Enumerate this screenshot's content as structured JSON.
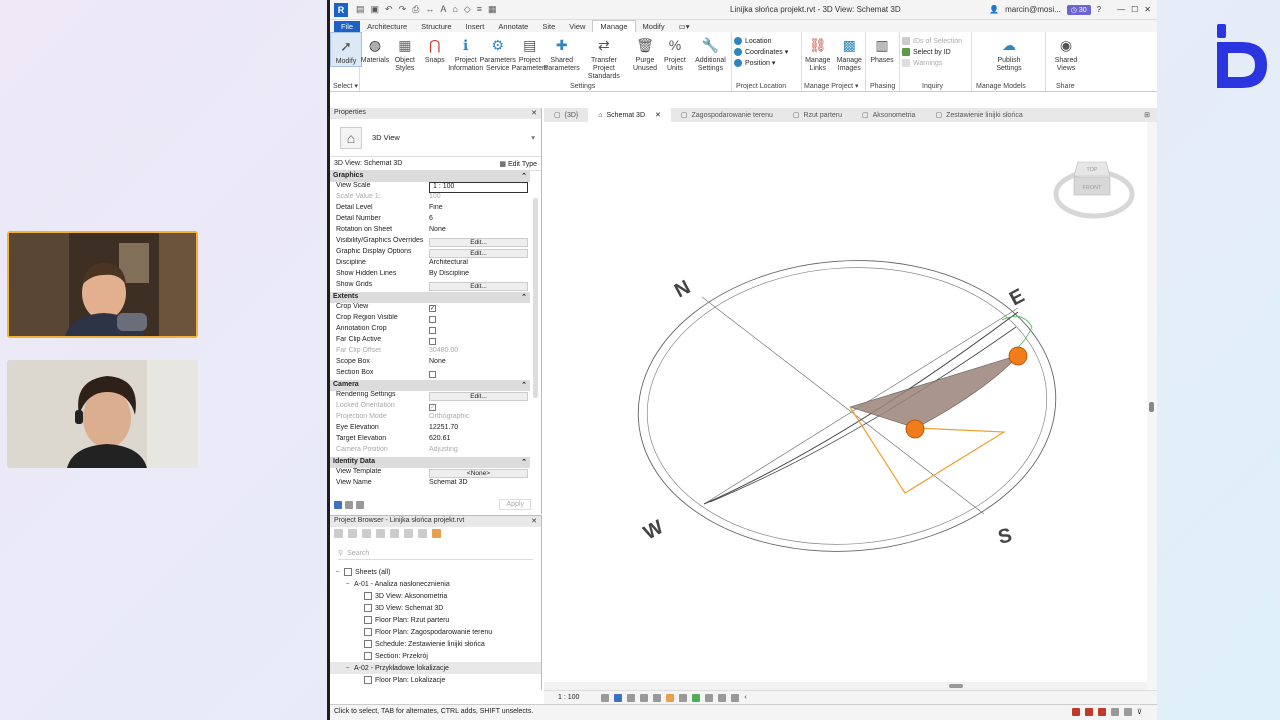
{
  "app": {
    "title": "Linijka słońca projekt.rvt - 3D View: Schemat 3D",
    "user": "marcin@mosi...",
    "badge": "30",
    "help": "?"
  },
  "ribbon_tabs": [
    "File",
    "Architecture",
    "Structure",
    "Insert",
    "Annotate",
    "Site",
    "View",
    "Manage",
    "Modify"
  ],
  "active_tab": "Manage",
  "ribbon": {
    "select": {
      "button": "Modify",
      "panel": "Select ▾"
    },
    "settings": {
      "buttons": [
        "Materials",
        "Object\nStyles",
        "Snaps",
        "Project\nInformation",
        "Parameters\nService",
        "Project\nParameters",
        "Shared\nParameters",
        "Transfer\nProject Standards",
        "Purge\nUnused",
        "Project\nUnits",
        "Additional\nSettings"
      ],
      "panel": "Settings"
    },
    "location": {
      "items": [
        "Location",
        "Coordinates ▾",
        "Position ▾"
      ],
      "panel": "Project Location"
    },
    "manage_project": {
      "buttons": [
        "Manage\nLinks",
        "Manage\nImages"
      ],
      "panel": "Manage Project ▾"
    },
    "phasing": {
      "button": "Phases",
      "panel": "Phasing"
    },
    "inquiry": {
      "items": [
        "IDs of Selection",
        "Select by ID",
        "Warnings"
      ],
      "panel": "Inquiry"
    },
    "manage_models": {
      "button": "Publish\nSettings",
      "panel": "Manage Models"
    },
    "share": {
      "button": "Shared\nViews",
      "panel": "Share"
    }
  },
  "properties": {
    "header": "Properties",
    "type_name": "3D View",
    "view_selector": "3D View: Schemat 3D",
    "edit_type": "Edit Type",
    "groups": [
      {
        "name": "Graphics",
        "rows": [
          {
            "k": "View Scale",
            "v": "1 : 100",
            "kind": "input"
          },
          {
            "k": "Scale Value  1:",
            "v": "100",
            "kind": "dim"
          },
          {
            "k": "Detail Level",
            "v": "Fine"
          },
          {
            "k": "Detail Number",
            "v": "6"
          },
          {
            "k": "Rotation on Sheet",
            "v": "None"
          },
          {
            "k": "Visibility/Graphics Overrides",
            "v": "Edit...",
            "kind": "btn"
          },
          {
            "k": "Graphic Display Options",
            "v": "Edit...",
            "kind": "btn"
          },
          {
            "k": "Discipline",
            "v": "Architectural"
          },
          {
            "k": "Show Hidden Lines",
            "v": "By Discipline"
          },
          {
            "k": "Show Grids",
            "v": "Edit...",
            "kind": "btn"
          }
        ]
      },
      {
        "name": "Extents",
        "rows": [
          {
            "k": "Crop View",
            "v": "✓",
            "kind": "chk"
          },
          {
            "k": "Crop Region Visible",
            "v": "",
            "kind": "chk"
          },
          {
            "k": "Annotation Crop",
            "v": "",
            "kind": "chk"
          },
          {
            "k": "Far Clip Active",
            "v": "",
            "kind": "chk"
          },
          {
            "k": "Far Clip Offset",
            "v": "30480.00",
            "kind": "dim"
          },
          {
            "k": "Scope Box",
            "v": "None"
          },
          {
            "k": "Section Box",
            "v": "",
            "kind": "chk"
          }
        ]
      },
      {
        "name": "Camera",
        "rows": [
          {
            "k": "Rendering Settings",
            "v": "Edit...",
            "kind": "btn"
          },
          {
            "k": "Locked Orientation",
            "v": "✓",
            "kind": "chkdim"
          },
          {
            "k": "Projection Mode",
            "v": "Orthographic",
            "kind": "dim"
          },
          {
            "k": "Eye Elevation",
            "v": "12251.70"
          },
          {
            "k": "Target Elevation",
            "v": "620.61"
          },
          {
            "k": "Camera Position",
            "v": "Adjusting",
            "kind": "dim"
          }
        ]
      },
      {
        "name": "Identity Data",
        "rows": [
          {
            "k": "View Template",
            "v": "<None>",
            "kind": "btn"
          },
          {
            "k": "View Name",
            "v": "Schemat 3D"
          }
        ]
      }
    ],
    "apply": "Apply"
  },
  "project_browser": {
    "header": "Project Browser - Linijka słońca projekt.rvt",
    "search_placeholder": "Search",
    "items": [
      {
        "label": "Sheets (all)",
        "level": 0,
        "toggle": "−"
      },
      {
        "label": "A-01 - Analiza nasłonecznienia",
        "level": 1,
        "toggle": "−"
      },
      {
        "label": "3D View: Aksonometria",
        "level": 2,
        "toggle": ""
      },
      {
        "label": "3D View: Schemat 3D",
        "level": 2,
        "toggle": ""
      },
      {
        "label": "Floor Plan: Rzut parteru",
        "level": 2,
        "toggle": ""
      },
      {
        "label": "Floor Plan: Zagospodarowanie terenu",
        "level": 2,
        "toggle": ""
      },
      {
        "label": "Schedule: Zestawienie linijki słońca",
        "level": 2,
        "toggle": ""
      },
      {
        "label": "Section: Przekrój",
        "level": 2,
        "toggle": ""
      },
      {
        "label": "A-02 - Przykładowe lokalizacje",
        "level": 1,
        "toggle": "−",
        "selected": true
      },
      {
        "label": "Floor Plan: Lokalizacje",
        "level": 2,
        "toggle": ""
      }
    ]
  },
  "view_tabs": [
    {
      "label": "{3D}",
      "active": false
    },
    {
      "label": "Schemat 3D",
      "active": true
    },
    {
      "label": "Zagospodarowanie terenu",
      "active": false
    },
    {
      "label": "Rzut parteru",
      "active": false
    },
    {
      "label": "Aksonometria",
      "active": false
    },
    {
      "label": "Zestawienie linijki słońca",
      "active": false
    }
  ],
  "compass": {
    "n": "N",
    "e": "E",
    "s": "S",
    "w": "W"
  },
  "viewcube": {
    "top": "TOP",
    "front": "FRONT"
  },
  "view_scale": "1 : 100",
  "status": "Click to select, TAB for alternates, CTRL adds, SHIFT unselects.",
  "colors": {
    "accent": "#1b62c4",
    "sun": "#f07d1a",
    "path": "#f0a030",
    "tile_border": "#f0b238",
    "logo": "#2a35e0"
  }
}
